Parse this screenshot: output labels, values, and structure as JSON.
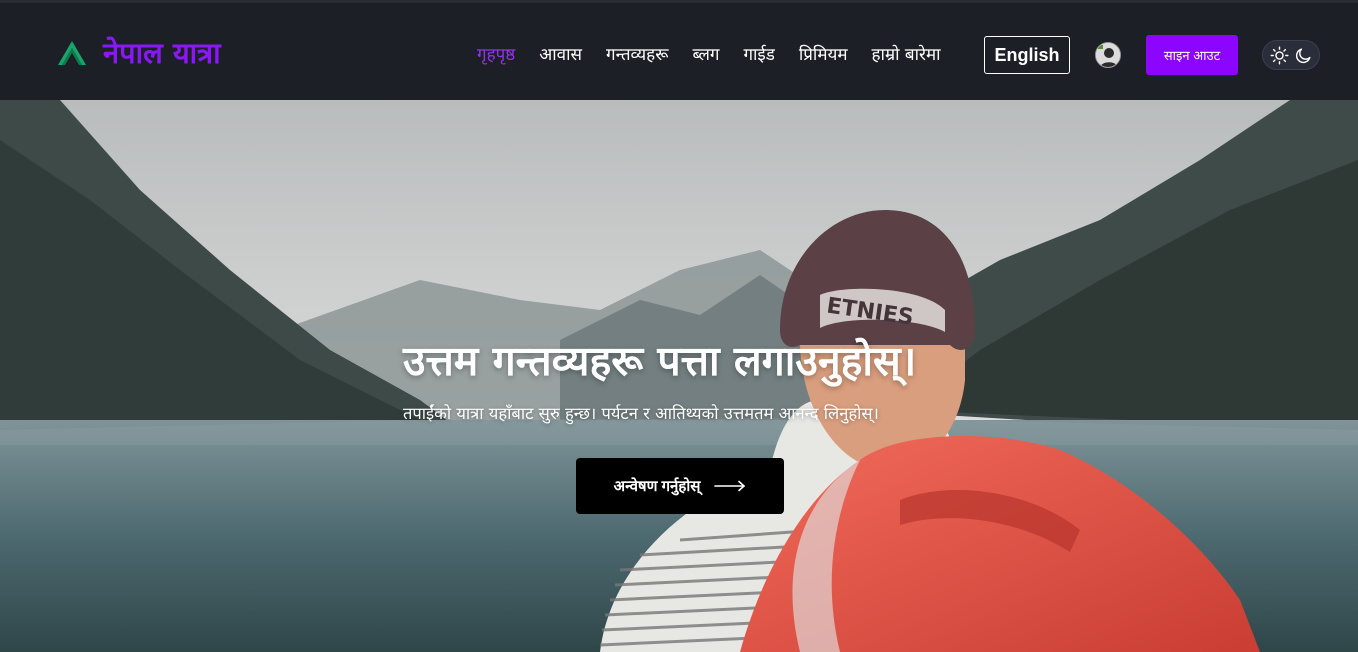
{
  "brand": {
    "name": "नेपाल यात्रा",
    "logo_icon": "mountain-logo-icon",
    "logo_colors": [
      "#17c27a",
      "#1a8f5a"
    ],
    "accent": "#8a17f5"
  },
  "nav": {
    "items": [
      {
        "label": "गृहपृष्ठ",
        "active": true
      },
      {
        "label": "आवास",
        "active": false
      },
      {
        "label": "गन्तव्यहरू",
        "active": false
      },
      {
        "label": "ब्लग",
        "active": false
      },
      {
        "label": "गाईड",
        "active": false
      },
      {
        "label": "प्रिमियम",
        "active": false
      },
      {
        "label": "हाम्रो बारेमा",
        "active": false
      }
    ]
  },
  "header": {
    "language_button": "English",
    "sign_out_button": "साइन आउट",
    "theme_toggle": {
      "icons": [
        "sun-icon",
        "moon-icon"
      ]
    }
  },
  "hero": {
    "title": "उत्तम गन्तव्यहरू पत्ता लगाउनुहोस्।",
    "subtitle": "तपाईंको यात्रा यहाँबाट सुरु हुन्छ। पर्यटन र आतिथ्यको उत्तमतम आनन्द लिनुहोस्।",
    "cta": "अन्वेषण गर्नुहोस्",
    "cta_icon": "arrow-right-icon",
    "cap_text": "ETNIES"
  }
}
